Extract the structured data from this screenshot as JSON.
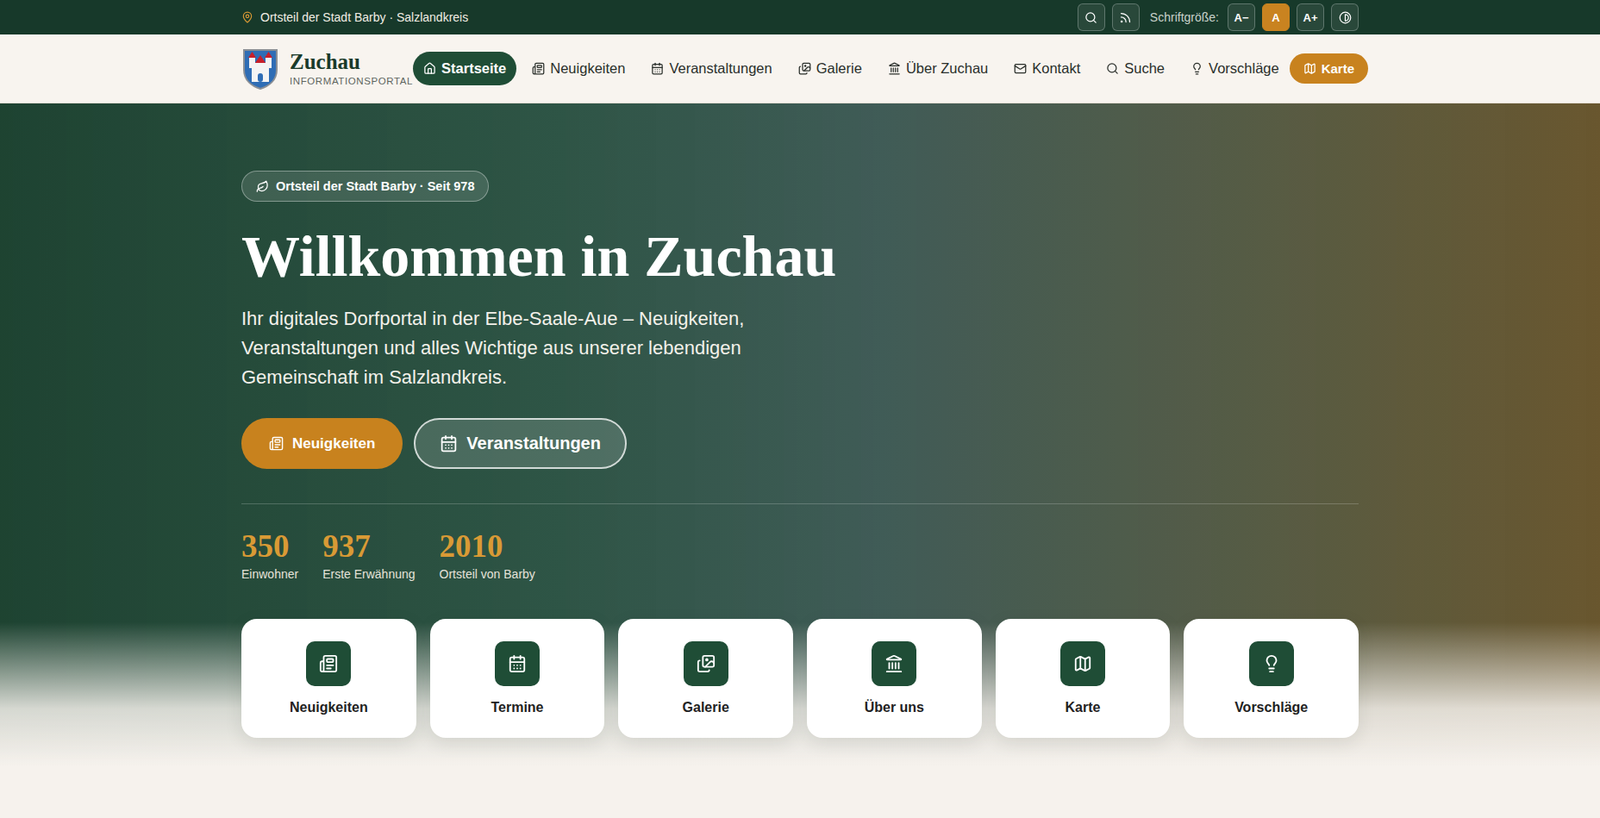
{
  "topbar": {
    "location": "Ortsteil der Stadt Barby · Salzlandkreis",
    "font_size_label": "Schriftgröße:",
    "font_sizes": [
      {
        "label": "A−",
        "selected": false
      },
      {
        "label": "A",
        "selected": true
      },
      {
        "label": "A+",
        "selected": false
      }
    ]
  },
  "logo": {
    "name": "Zuchau",
    "subtitle": "INFORMATIONSPORTAL"
  },
  "nav": {
    "items": [
      {
        "label": "Startseite",
        "selected": true
      },
      {
        "label": "Neuigkeiten",
        "selected": false
      },
      {
        "label": "Veranstaltungen",
        "selected": false
      },
      {
        "label": "Galerie",
        "selected": false
      },
      {
        "label": "Über Zuchau",
        "selected": false
      },
      {
        "label": "Kontakt",
        "selected": false
      },
      {
        "label": "Suche",
        "selected": false
      },
      {
        "label": "Vorschläge",
        "selected": false
      }
    ],
    "map_button": "Karte"
  },
  "hero": {
    "badge": "Ortsteil der Stadt Barby · Seit 978",
    "title": "Willkommen in Zuchau",
    "subtitle": "Ihr digitales Dorfportal in der Elbe-Saale-Aue – Neuigkeiten, Veranstaltungen und alles Wichtige aus unserer lebendigen Gemeinschaft im Salzlandkreis.",
    "buttons": [
      {
        "label": "Neuigkeiten",
        "kind": "primary"
      },
      {
        "label": "Veranstaltungen",
        "kind": "outline"
      }
    ],
    "stats": [
      {
        "value": "350",
        "label": "Einwohner"
      },
      {
        "value": "937",
        "label": "Erste Erwähnung"
      },
      {
        "value": "2010",
        "label": "Ortsteil von Barby"
      }
    ]
  },
  "quick_links": [
    {
      "label": "Neuigkeiten"
    },
    {
      "label": "Termine"
    },
    {
      "label": "Galerie"
    },
    {
      "label": "Über uns"
    },
    {
      "label": "Karte"
    },
    {
      "label": "Vorschläge"
    }
  ]
}
